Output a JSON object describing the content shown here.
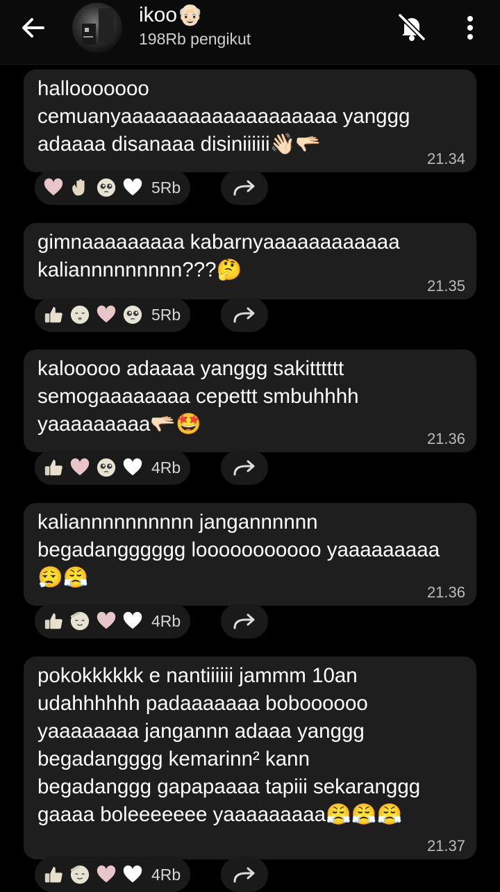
{
  "header": {
    "channel_name": "ikoo👴🏻",
    "followers": "198Rb pengikut"
  },
  "messages": [
    {
      "text": "hallooooooo\ncemuanyaaaaaaaaaaaaaaaaaaa yanggg\nadaaaa disanaaa disiniiiiii👋🏻🫳🏻",
      "time": "21.34",
      "reactions": [
        "heart-pink",
        "waving-hand",
        "pleading-face",
        "white-heart"
      ],
      "count": "5Rb"
    },
    {
      "text": "gimnaaaaaaaaa kabarnyaaaaaaaaaaaa\nkaliannnnnnnnn???🤔",
      "time": "21.35",
      "reactions": [
        "thumbs-up",
        "grimace-face",
        "heart-pink",
        "pleading-face"
      ],
      "count": "5Rb"
    },
    {
      "text": "kalooooo adaaaa yanggg sakitttttt\nsemogaaaaaaaa cepettt smbuhhhh\nyaaaaaaaaa🫳🏻🤩",
      "time": "21.36",
      "reactions": [
        "thumbs-up",
        "heart-pink",
        "pleading-face",
        "white-heart"
      ],
      "count": "4Rb"
    },
    {
      "text": "kaliannnnnnnnnn jangannnnnn\nbegadangggggg looooooooooo yaaaaaaaaa\n😮‍💨😤",
      "time": "21.36",
      "reactions": [
        "thumbs-up",
        "saluting-face",
        "heart-pink",
        "white-heart"
      ],
      "count": "4Rb"
    },
    {
      "text": "pokokkkkkk e nantiiiiii jammm 10an\nudahhhhhh padaaaaaaa boboooooo\nyaaaaaaaa jangannn adaaa yanggg\nbegadangggg kemarinn² kann\nbegadanggg gapapaaaa tapiii sekaranggg\ngaaaa boleeeeeee yaaaaaaaaa😤😤😤",
      "time": "21.37",
      "reactions": [
        "thumbs-up",
        "saluting-face",
        "heart-pink",
        "white-heart"
      ],
      "count": "4Rb"
    }
  ],
  "colors": {
    "background": "#000000",
    "bubble": "#1e1e1e",
    "pill": "#1a1a1a",
    "time": "#bbbbbb",
    "heart_pink": "#e8c5c8"
  }
}
